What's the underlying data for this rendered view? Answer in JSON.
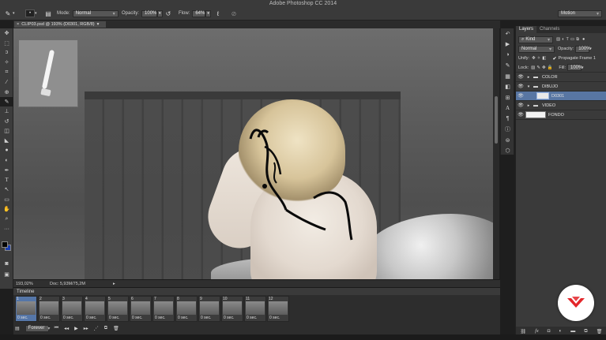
{
  "app": {
    "window_title": "Adobe Photoshop CC 2014",
    "workspace": "Motion"
  },
  "options_bar": {
    "mode_label": "Mode:",
    "mode_value": "Normal",
    "opacity_label": "Opacity:",
    "opacity_value": "100%",
    "flow_label": "Flow:",
    "flow_value": "64%"
  },
  "document": {
    "tab_title": "CLIP03.psd @ 193% (D0301, RGB/8)",
    "zoom": "193,02%",
    "doc_info": "Doc: 5,93M/75,2M"
  },
  "timeline": {
    "title": "Timeline",
    "loop": "Forever",
    "frames": [
      {
        "num": "1",
        "dur": "0 sec."
      },
      {
        "num": "2",
        "dur": "0 sec."
      },
      {
        "num": "3",
        "dur": "0 sec."
      },
      {
        "num": "4",
        "dur": "0 sec."
      },
      {
        "num": "5",
        "dur": "0 sec."
      },
      {
        "num": "6",
        "dur": "0 sec."
      },
      {
        "num": "7",
        "dur": "0 sec."
      },
      {
        "num": "8",
        "dur": "0 sec."
      },
      {
        "num": "9",
        "dur": "0 sec."
      },
      {
        "num": "10",
        "dur": "0 sec."
      },
      {
        "num": "11",
        "dur": "0 sec."
      },
      {
        "num": "12",
        "dur": "0 sec."
      }
    ],
    "selected_frame": 1
  },
  "layers_panel": {
    "tab_layers": "Layers",
    "tab_channels": "Channels",
    "filter_kind": "Kind",
    "blend_mode": "Normal",
    "opacity_label": "Opacity:",
    "opacity_value": "100%",
    "unify_label": "Unify:",
    "propagate_label": "Propagate Frame 1",
    "lock_label": "Lock:",
    "fill_label": "Fill:",
    "fill_value": "100%",
    "layers": [
      {
        "name": "COLOR",
        "type": "group",
        "expanded": false
      },
      {
        "name": "DIBUJO",
        "type": "group",
        "expanded": true
      },
      {
        "name": "D0301",
        "type": "layer",
        "selected": true
      },
      {
        "name": "VIDEO",
        "type": "group",
        "expanded": false
      },
      {
        "name": "FONDO",
        "type": "layer"
      }
    ]
  },
  "colors": {
    "foreground": "#050505",
    "background": "#1a3fb0",
    "selection": "#5876a3",
    "logo_accent": "#e3262a"
  }
}
